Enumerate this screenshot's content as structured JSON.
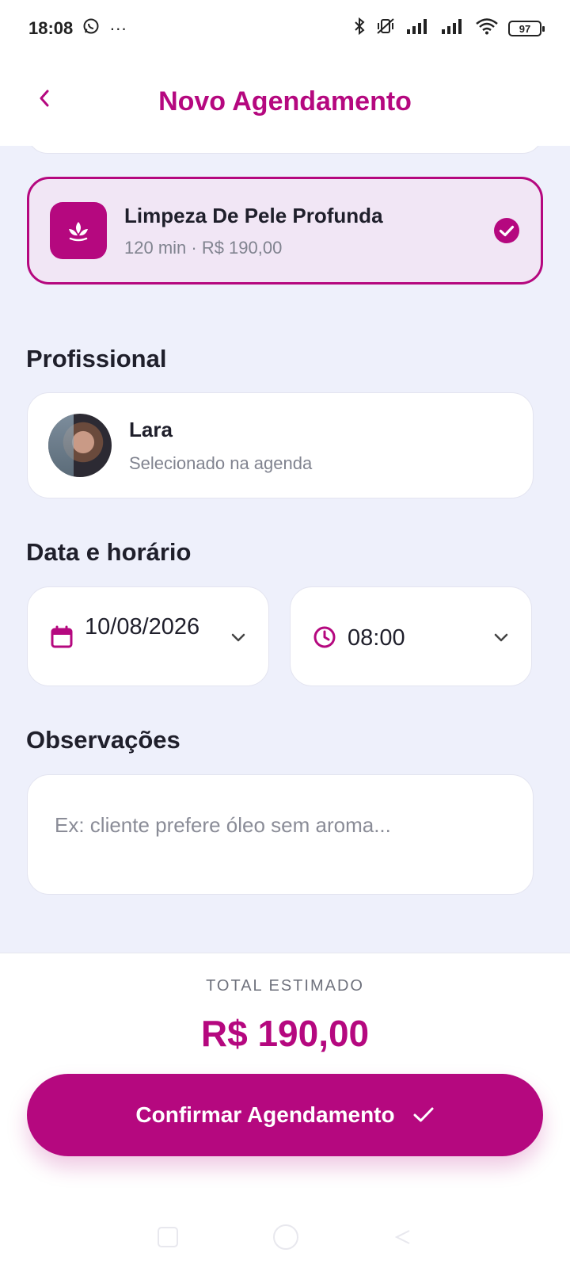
{
  "status_bar": {
    "time": "18:08",
    "more": "···",
    "battery": "97"
  },
  "header": {
    "title": "Novo Agendamento"
  },
  "service": {
    "name": "Limpeza De Pele Profunda",
    "meta": "120 min · R$ 190,00",
    "selected": true
  },
  "professional": {
    "section_title": "Profissional",
    "name": "Lara",
    "subtitle": "Selecionado na agenda"
  },
  "schedule": {
    "section_title": "Data e horário",
    "date": "10/08/2026",
    "time": "08:00"
  },
  "notes": {
    "section_title": "Observações",
    "value": "",
    "placeholder": "Ex: cliente prefere óleo sem aroma..."
  },
  "footer": {
    "total_label": "TOTAL ESTIMADO",
    "total_value": "R$ 190,00",
    "confirm_label": "Confirmar Agendamento"
  },
  "colors": {
    "accent": "#b5087f",
    "background": "#eef0fb",
    "selected_card": "#f1e6f5",
    "muted_text": "#80838f"
  },
  "icons": {
    "back": "chevron-left-icon",
    "service": "lotus-icon",
    "selected": "check-circle-icon",
    "date": "calendar-icon",
    "time": "clock-icon",
    "dropdown": "chevron-down-icon",
    "confirm": "check-icon"
  }
}
